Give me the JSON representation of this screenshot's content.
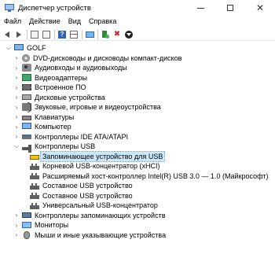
{
  "window": {
    "title": "Диспетчер устройств",
    "controls": {
      "minimize": "—",
      "maximize": "☐",
      "close": "✕"
    }
  },
  "menu": [
    "Файл",
    "Действие",
    "Вид",
    "Справка"
  ],
  "toolbar": {
    "buttons": [
      {
        "name": "back-icon"
      },
      {
        "name": "forward-icon"
      },
      {
        "name": "properties-icon"
      },
      {
        "name": "show-hidden-icon"
      },
      {
        "name": "help-icon",
        "glyph": "?"
      },
      {
        "name": "grid-view-icon"
      },
      {
        "name": "scan-hardware-icon"
      },
      {
        "name": "update-driver-icon"
      },
      {
        "name": "uninstall-icon",
        "glyph": "✖"
      },
      {
        "name": "disable-device-icon"
      }
    ]
  },
  "tree": {
    "root": "GOLF",
    "expand_open_glyph": "⌵",
    "expand_closed_glyph": "›",
    "items": [
      {
        "label": "DVD-дисководы и дисководы компакт-дисков",
        "icon": "disc",
        "expanded": false,
        "level": 1
      },
      {
        "label": "Аудиовходы и аудиовыходы",
        "icon": "audio",
        "expanded": false,
        "level": 1
      },
      {
        "label": "Видеоадаптеры",
        "icon": "video",
        "expanded": false,
        "level": 1
      },
      {
        "label": "Встроенное ПО",
        "icon": "chip",
        "expanded": false,
        "level": 1
      },
      {
        "label": "Дисковые устройства",
        "icon": "disk",
        "expanded": false,
        "level": 1
      },
      {
        "label": "Звуковые, игровые и видеоустройства",
        "icon": "sound",
        "expanded": false,
        "level": 1
      },
      {
        "label": "Клавиатуры",
        "icon": "keyboard",
        "expanded": false,
        "level": 1
      },
      {
        "label": "Компьютер",
        "icon": "computer",
        "expanded": false,
        "level": 1
      },
      {
        "label": "Контроллеры IDE ATA/ATAPI",
        "icon": "ide",
        "expanded": false,
        "level": 1
      },
      {
        "label": "Контроллеры USB",
        "icon": "usb",
        "expanded": true,
        "level": 1
      },
      {
        "label": "Запоминающее устройство для USB",
        "icon": "storage-usb",
        "level": 2,
        "selected": true
      },
      {
        "label": "Корневой USB-концентратор (xHCI)",
        "icon": "hub",
        "level": 2
      },
      {
        "label": "Расширяемый хост-контроллер Intel(R) USB 3.0 — 1.0 (Майкрософт)",
        "icon": "hub",
        "level": 2
      },
      {
        "label": "Составное USB устройство",
        "icon": "hub",
        "level": 2
      },
      {
        "label": "Составное USB устройство",
        "icon": "hub",
        "level": 2
      },
      {
        "label": "Универсальный USB-концентратор",
        "icon": "hub",
        "level": 2
      },
      {
        "label": "Контроллеры запоминающих устройств",
        "icon": "storage-ctrl",
        "expanded": false,
        "level": 1
      },
      {
        "label": "Мониторы",
        "icon": "monitor",
        "expanded": false,
        "level": 1
      },
      {
        "label": "Мыши и иные указывающие устройства",
        "icon": "mouse",
        "expanded": false,
        "level": 1
      }
    ]
  }
}
